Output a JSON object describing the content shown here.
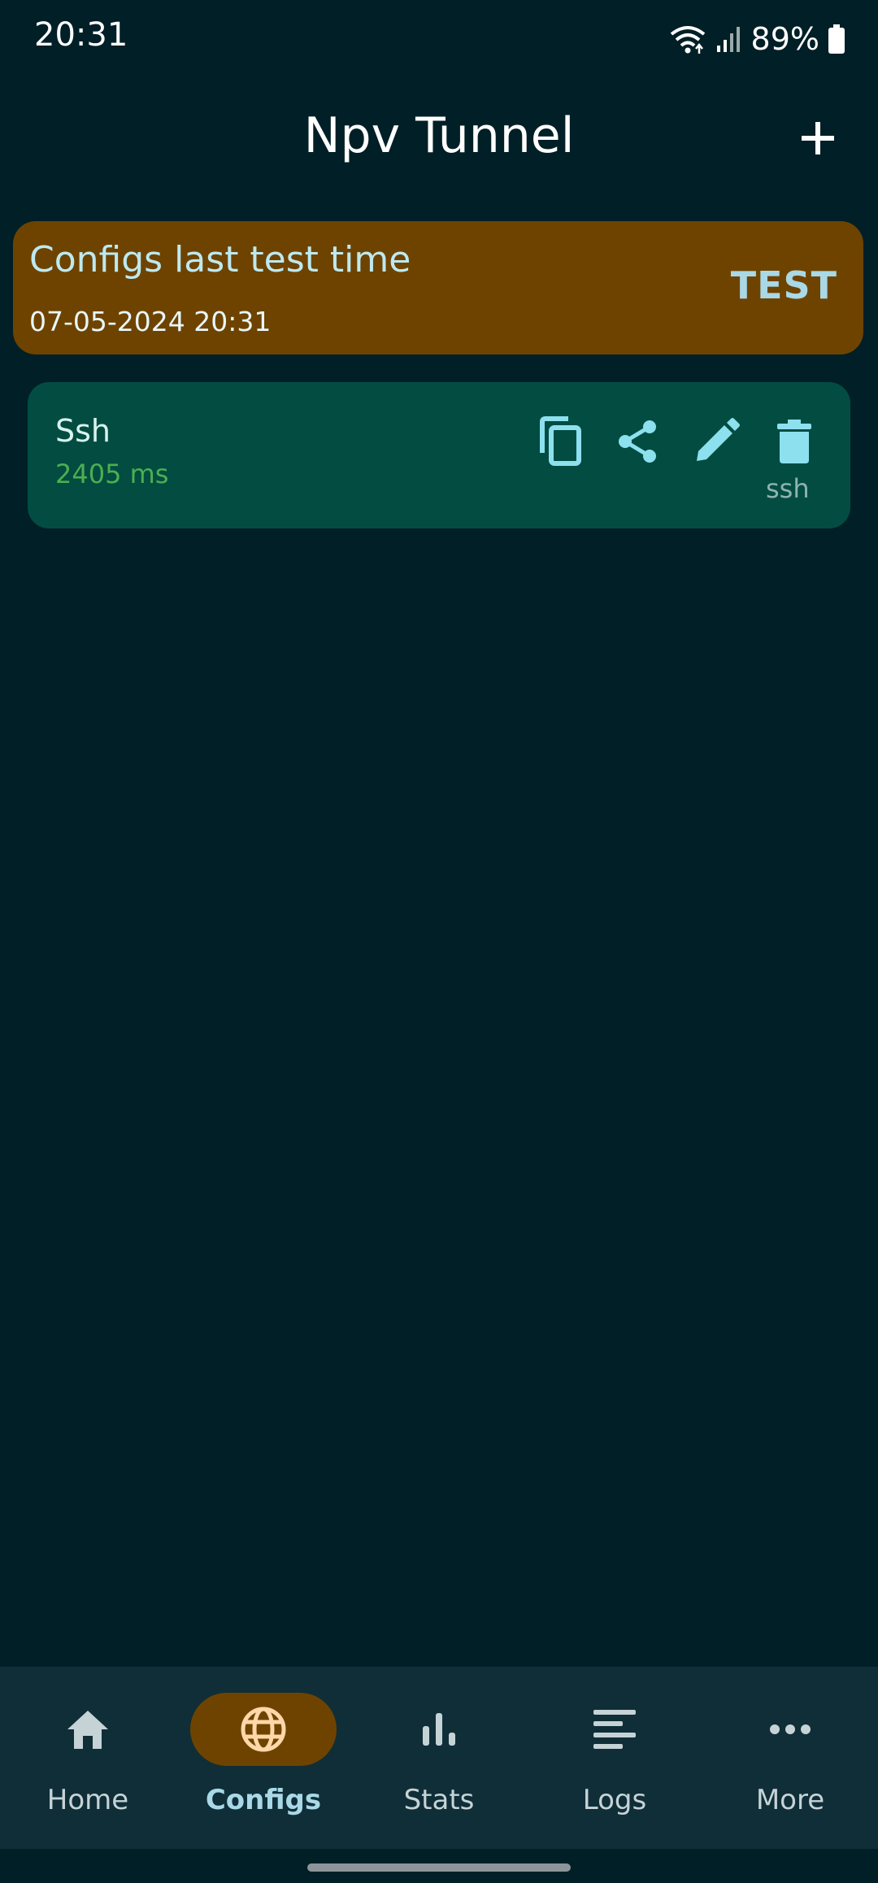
{
  "status_bar": {
    "time": "20:31",
    "battery": "89%",
    "icons": [
      "wifi-icon",
      "signal-icon",
      "battery-icon"
    ]
  },
  "header": {
    "title": "Npv Tunnel",
    "add_icon": "plus-icon"
  },
  "test_banner": {
    "title": "Configs last test time",
    "timestamp": "07-05-2024 20:31",
    "button_label": "TEST"
  },
  "configs": [
    {
      "name": "Ssh",
      "latency": "2405 ms",
      "type": "ssh",
      "actions": [
        "copy-icon",
        "share-icon",
        "edit-icon",
        "delete-icon"
      ]
    }
  ],
  "bottom_nav": {
    "items": [
      {
        "label": "Home",
        "icon": "home-icon",
        "active": false
      },
      {
        "label": "Configs",
        "icon": "globe-icon",
        "active": true
      },
      {
        "label": "Stats",
        "icon": "bar-chart-icon",
        "active": false
      },
      {
        "label": "Logs",
        "icon": "lines-icon",
        "active": false
      },
      {
        "label": "More",
        "icon": "more-dots-icon",
        "active": false
      }
    ]
  },
  "colors": {
    "background": "#001f26",
    "banner": "#6e4300",
    "card": "#034c41",
    "nav": "#0f2e38",
    "accent": "#a9d8e6",
    "latency": "#4caf50"
  }
}
